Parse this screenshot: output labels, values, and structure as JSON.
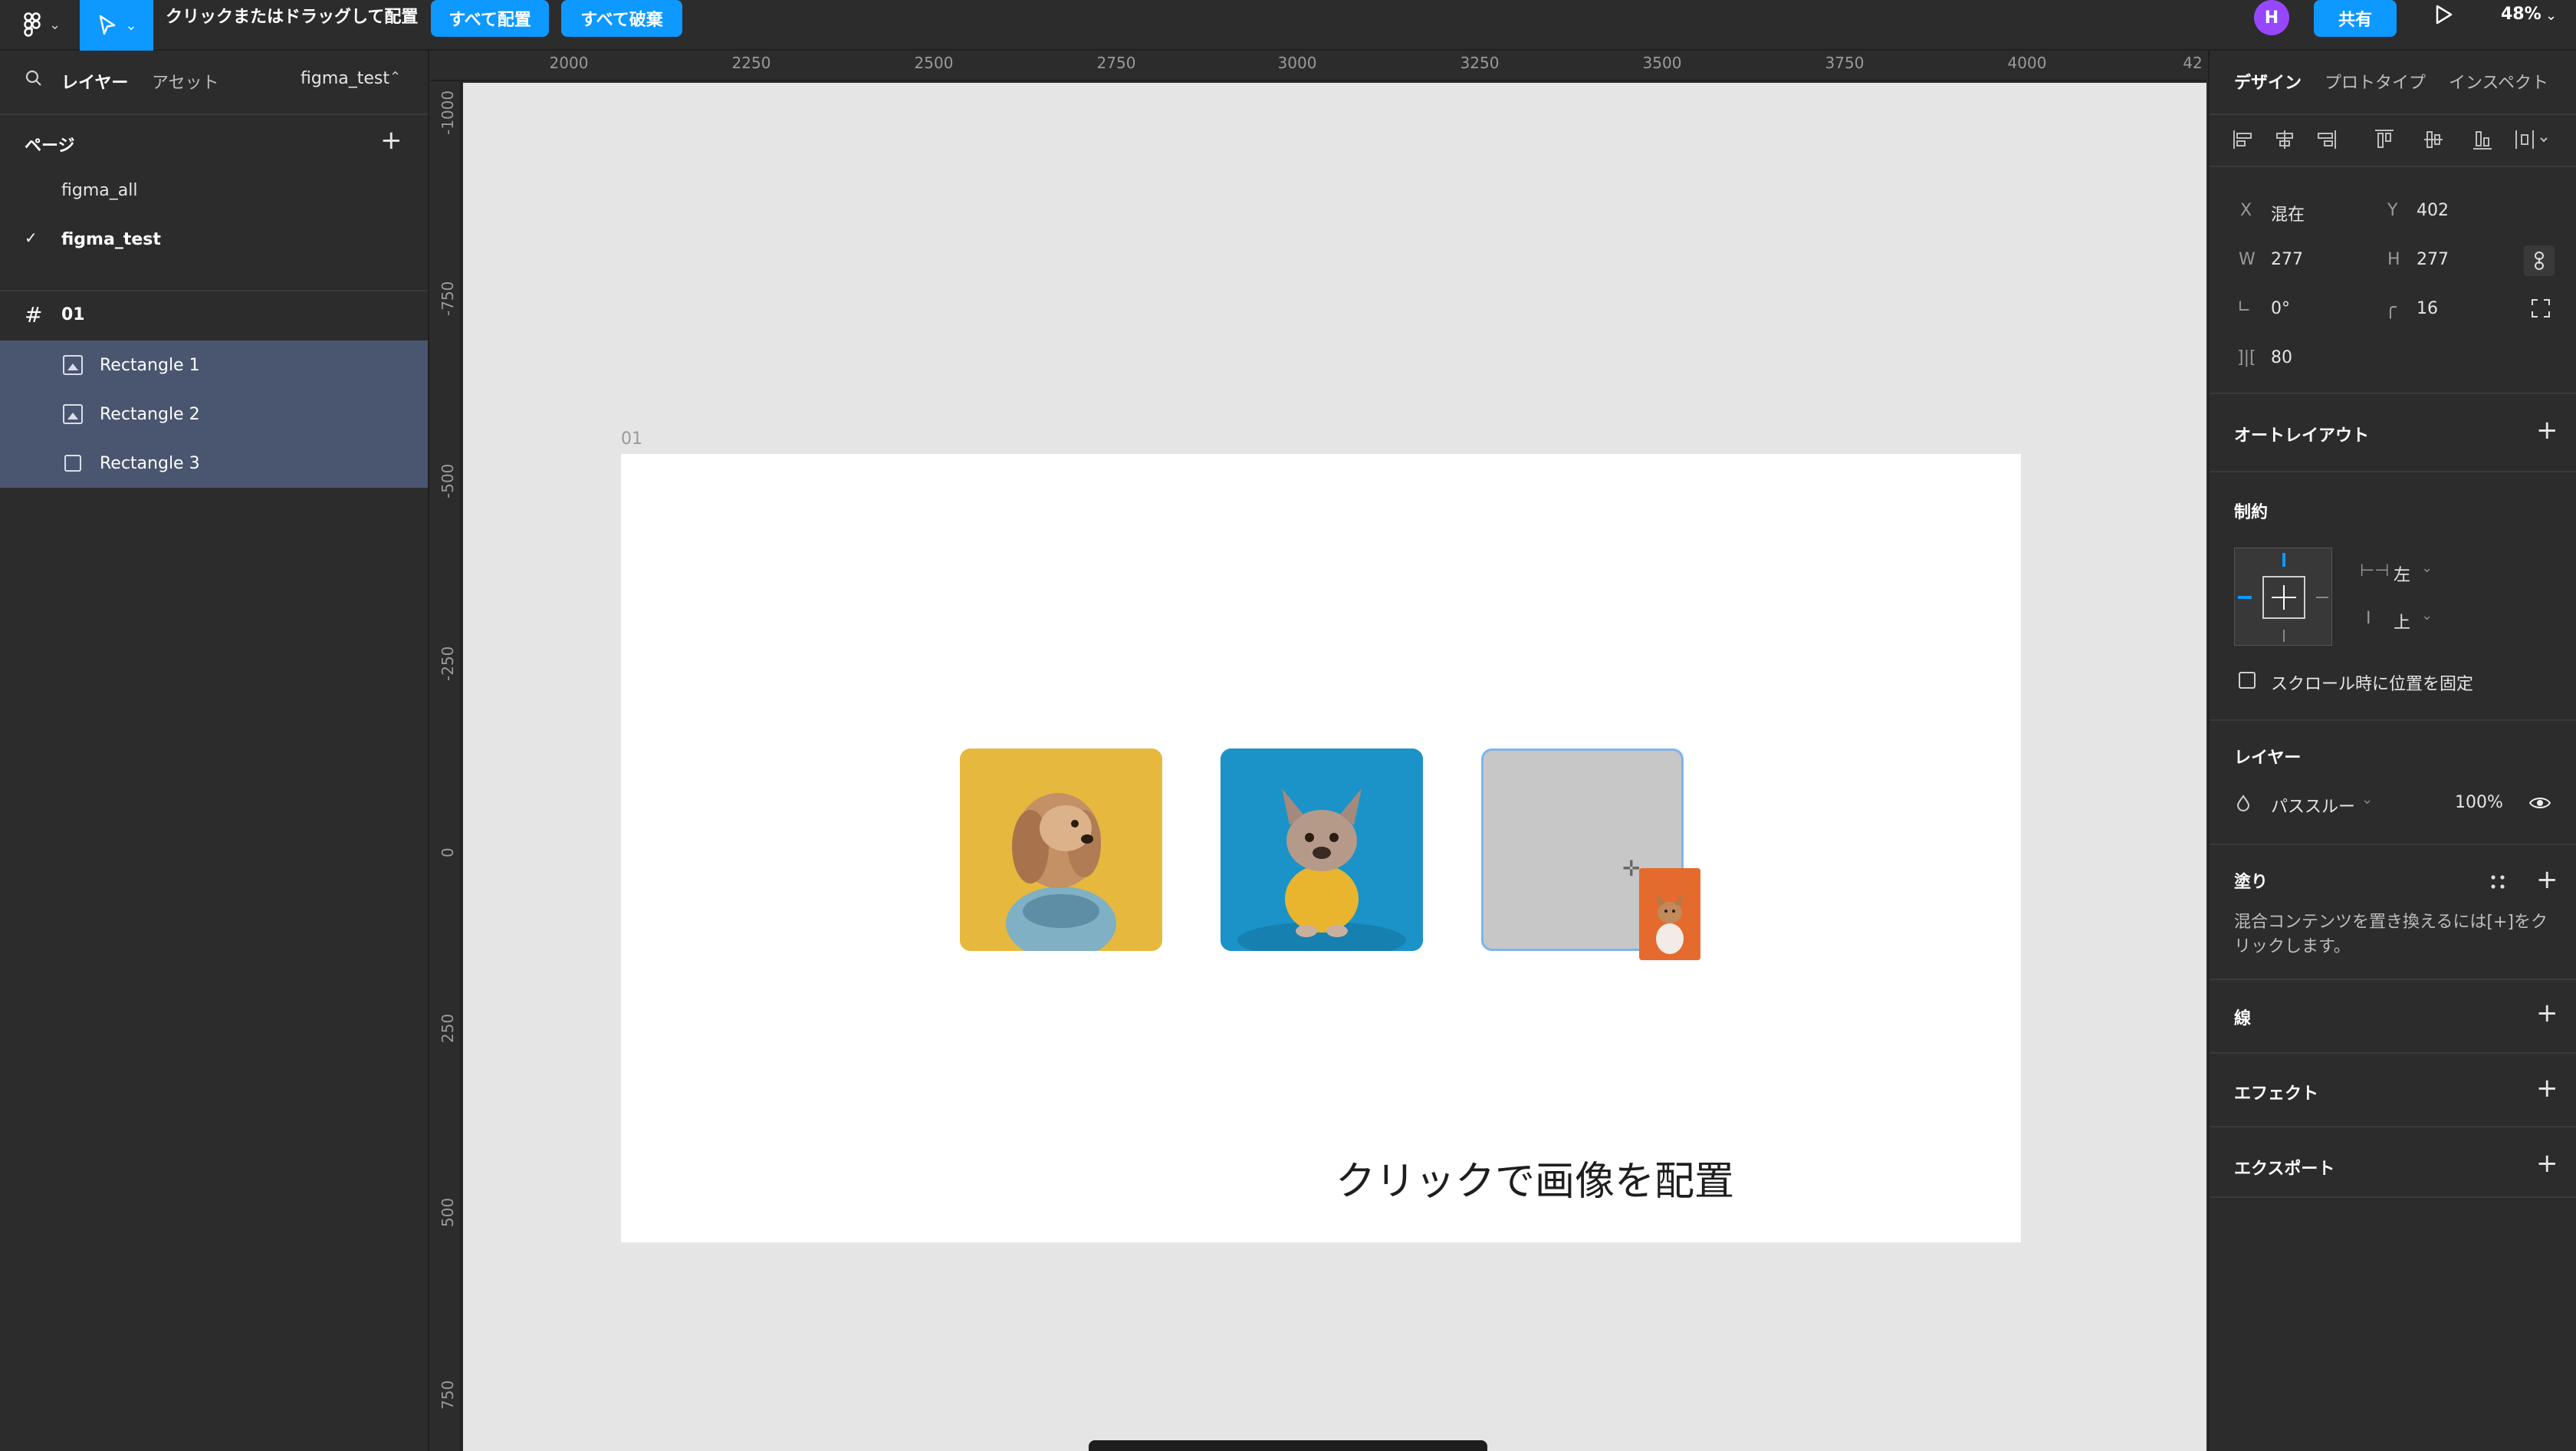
{
  "toolbar": {
    "hint": "クリックまたはドラッグして配置",
    "place_all": "すべて配置",
    "discard_all": "すべて破棄",
    "avatar_initial": "H",
    "share": "共有",
    "zoom": "48%"
  },
  "left_panel": {
    "tabs": {
      "layers": "レイヤー",
      "assets": "アセット"
    },
    "file_name": "figma_test",
    "pages_header": "ページ",
    "pages": [
      {
        "name": "figma_all"
      },
      {
        "name": "figma_test"
      }
    ],
    "frame_name": "01",
    "layers": [
      {
        "name": "Rectangle 1"
      },
      {
        "name": "Rectangle 2"
      },
      {
        "name": "Rectangle 3"
      }
    ]
  },
  "rulers": {
    "horizontal": [
      "2000",
      "2250",
      "2500",
      "2750",
      "3000",
      "3250",
      "3500",
      "3750",
      "4000",
      "42"
    ],
    "vertical": [
      "-1000",
      "-750",
      "-500",
      "-250",
      "0",
      "250",
      "500",
      "750"
    ]
  },
  "canvas": {
    "frame_label": "01",
    "caption": "クリックで画像を配置"
  },
  "right_panel": {
    "tabs": {
      "design": "デザイン",
      "prototype": "プロトタイプ",
      "inspect": "インスペクト"
    },
    "props": {
      "x_label": "X",
      "x_value": "混在",
      "y_label": "Y",
      "y_value": "402",
      "w_label": "W",
      "w_value": "277",
      "h_label": "H",
      "h_value": "277",
      "rotation": "0°",
      "radius": "16",
      "spacing": "80"
    },
    "auto_layout": "オートレイアウト",
    "constraints": {
      "title": "制約",
      "horizontal": "左",
      "vertical": "上",
      "fix_scroll": "スクロール時に位置を固定"
    },
    "layer": {
      "title": "レイヤー",
      "blend": "パススルー",
      "opacity": "100%"
    },
    "fill": {
      "title": "塗り",
      "hint_line1": "混合コンテンツを置き換えるには[+]をク",
      "hint_line2": "リックします。"
    },
    "stroke": "線",
    "effects": "エフェクト",
    "export": "エクスポート"
  },
  "colors": {
    "accent": "#0d99ff",
    "avatar": "#9747ff",
    "selection": "#4a5670"
  }
}
